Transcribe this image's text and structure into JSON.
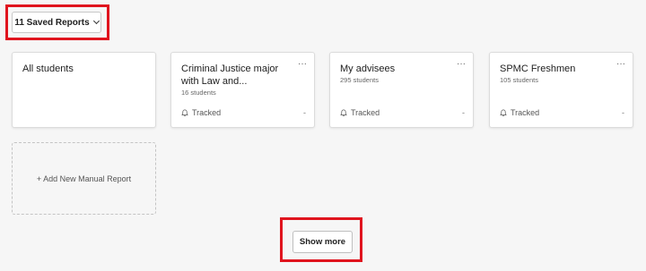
{
  "saved_reports": {
    "label": "11 Saved Reports"
  },
  "cards": [
    {
      "title": "All students",
      "count": "",
      "status": "",
      "dash": ""
    },
    {
      "title": "Criminal Justice major with Law and...",
      "count": "16 students",
      "status": "Tracked",
      "dash": "-"
    },
    {
      "title": "My advisees",
      "count": "295 students",
      "status": "Tracked",
      "dash": "-"
    },
    {
      "title": "SPMC Freshmen",
      "count": "105 students",
      "status": "Tracked",
      "dash": "-"
    }
  ],
  "menu_glyph": "···",
  "add_report": {
    "label": "+ Add New Manual Report"
  },
  "show_more": {
    "label": "Show more"
  },
  "colors": {
    "highlight": "#e0141e",
    "background": "#f6f6f6",
    "card": "#ffffff"
  },
  "icons": {
    "tracked": "bell-icon",
    "dropdown": "chevron-down-icon",
    "menu": "more-horizontal-icon"
  }
}
